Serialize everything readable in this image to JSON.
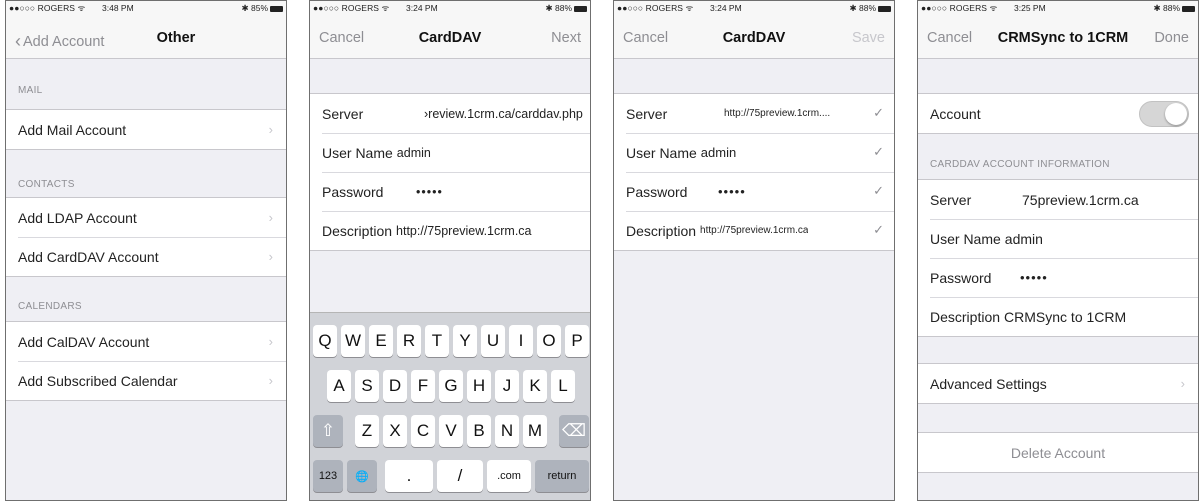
{
  "status": [
    {
      "carrier": "●●○○○ ROGERS ᯤ",
      "time": "3:48 PM",
      "battery": "✱ 85%"
    },
    {
      "carrier": "●●○○○ ROGERS ᯤ",
      "time": "3:24 PM",
      "battery": "✱ 88%"
    },
    {
      "carrier": "●●○○○ ROGERS ᯤ",
      "time": "3:24 PM",
      "battery": "✱ 88%"
    },
    {
      "carrier": "●●○○○ ROGERS ᯤ",
      "time": "3:25 PM",
      "battery": "✱ 88%"
    }
  ],
  "screen1": {
    "back_label": "Add Account",
    "title": "Other",
    "mail_header": "MAIL",
    "mail_items": [
      "Add Mail Account"
    ],
    "contacts_header": "CONTACTS",
    "contacts_items": [
      "Add LDAP Account",
      "Add CardDAV Account"
    ],
    "calendars_header": "CALENDARS",
    "calendars_items": [
      "Add CalDAV Account",
      "Add Subscribed Calendar"
    ]
  },
  "screen2": {
    "cancel": "Cancel",
    "title": "CardDAV",
    "next": "Next",
    "server_label": "Server",
    "server_value": "›review.1crm.ca/carddav.php",
    "user_label": "User Name",
    "user_value": "admin",
    "password_label": "Password",
    "password_value": "•••••",
    "description_label": "Description",
    "description_value": "http://75preview.1crm.ca",
    "keyboard": {
      "row1": [
        "Q",
        "W",
        "E",
        "R",
        "T",
        "Y",
        "U",
        "I",
        "O",
        "P"
      ],
      "row2": [
        "A",
        "S",
        "D",
        "F",
        "G",
        "H",
        "J",
        "K",
        "L"
      ],
      "row3": [
        "Z",
        "X",
        "C",
        "V",
        "B",
        "N",
        "M"
      ],
      "shift": "⇧",
      "delete": "⌫",
      "numbers": "123",
      "globe": "🌐",
      "dot": ".",
      "slash": "/",
      "dotcom": ".com",
      "return": "return"
    }
  },
  "screen3": {
    "cancel": "Cancel",
    "title": "CardDAV",
    "save": "Save",
    "server_label": "Server",
    "server_value": "http://75preview.1crm....",
    "user_label": "User Name",
    "user_value": "admin",
    "password_label": "Password",
    "password_value": "•••••",
    "description_label": "Description",
    "description_value": "http://75preview.1crm.ca",
    "check": "✓"
  },
  "screen4": {
    "cancel": "Cancel",
    "title": "CRMSync to 1CRM",
    "done": "Done",
    "account_label": "Account",
    "account_toggle_on": false,
    "info_header": "CARDDAV ACCOUNT INFORMATION",
    "server_label": "Server",
    "server_value": "75preview.1crm.ca",
    "user_label": "User Name",
    "user_value": "admin",
    "password_label": "Password",
    "password_value": "•••••",
    "description_label": "Description",
    "description_value": "CRMSync to 1CRM",
    "advanced_label": "Advanced Settings",
    "delete_label": "Delete Account"
  },
  "icons": {
    "chevron": "›",
    "back_chevron": "‹"
  }
}
